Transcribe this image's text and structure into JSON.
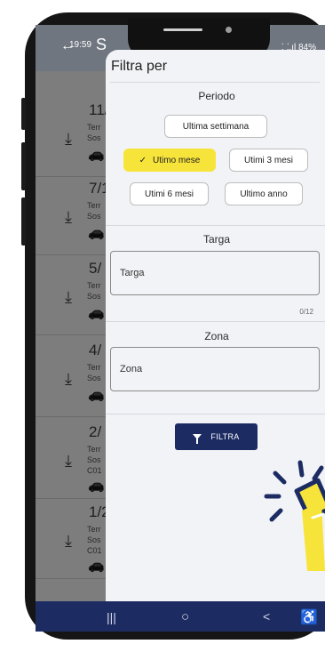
{
  "status": {
    "time": "19:59",
    "right": "⸬.ıl 84%"
  },
  "appbar": {
    "back": "←",
    "title": "S"
  },
  "list": [
    {
      "date": "11/",
      "line1": "Terr",
      "line2": "Sos",
      "line3": ""
    },
    {
      "date": "7/1",
      "line1": "Terr",
      "line2": "Sos",
      "line3": ""
    },
    {
      "date": "5/",
      "line1": "Terr",
      "line2": "Sos",
      "line3": ""
    },
    {
      "date": "4/",
      "line1": "Terr",
      "line2": "Sos",
      "line3": ""
    },
    {
      "date": "2/",
      "line1": "Terr",
      "line2": "Sos",
      "line3": "C01"
    },
    {
      "date": "1/2",
      "line1": "Terr",
      "line2": "Sos",
      "line3": "C01"
    }
  ],
  "panel": {
    "title": "Filtra per",
    "periodo": {
      "label": "Periodo",
      "options": [
        "Ultima settimana",
        "Utimo mese",
        "Utimi 3 mesi",
        "Utimi 6 mesi",
        "Ultimo anno"
      ],
      "selected": "Utimo mese",
      "check": "✓"
    },
    "targa": {
      "label": "Targa",
      "placeholder": "Targa",
      "counter": "0/12"
    },
    "zona": {
      "label": "Zona",
      "placeholder": "Zona"
    },
    "button": "FILTRA"
  },
  "navbar": {
    "recents": "|||",
    "home": "○",
    "back": "<",
    "accessibility": "⚗"
  },
  "colors": {
    "accent": "#f7e43a",
    "brand": "#1c2c63",
    "panel_bg": "#f2f3f7"
  }
}
